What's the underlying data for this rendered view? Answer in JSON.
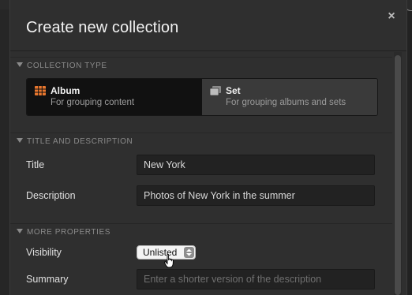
{
  "dialog": {
    "title": "Create new collection",
    "close_label": "×"
  },
  "sections": {
    "collection_type": "COLLECTION TYPE",
    "title_description": "TITLE AND DESCRIPTION",
    "more_properties": "MORE PROPERTIES"
  },
  "collection_types": [
    {
      "name": "Album",
      "description": "For grouping content",
      "icon": "album-grid-icon",
      "selected": true
    },
    {
      "name": "Set",
      "description": "For grouping albums and sets",
      "icon": "set-stack-icon",
      "selected": false
    }
  ],
  "fields": {
    "title": {
      "label": "Title",
      "value": "New York"
    },
    "description": {
      "label": "Description",
      "value": "Photos of New York in the summer"
    },
    "visibility": {
      "label": "Visibility",
      "value": "Unlisted"
    },
    "summary": {
      "label": "Summary",
      "value": "",
      "placeholder": "Enter a shorter version of the description"
    }
  },
  "colors": {
    "accent": "#e8772e",
    "dialog_bg": "#2f2f2f",
    "selected_bg": "#111111"
  }
}
